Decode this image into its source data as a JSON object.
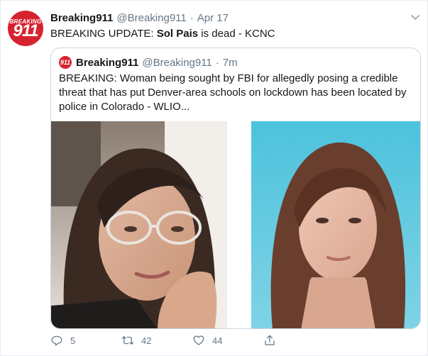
{
  "tweet": {
    "avatar": {
      "line1": "BREAKING",
      "line2": "911"
    },
    "display_name": "Breaking911",
    "handle": "@Breaking911",
    "separator": "·",
    "time": "Apr 17",
    "text_prefix": "BREAKING UPDATE: ",
    "text_bold": "Sol Pais",
    "text_suffix": " is dead - KCNC"
  },
  "quoted_tweet": {
    "avatar": "911",
    "display_name": "Breaking911",
    "handle": "@Breaking911",
    "separator": "·",
    "time": "7m",
    "text": "BREAKING: Woman being sought by FBI for allegedly posing a credible threat that has put Denver-area schools on lockdown has been located by police in Colorado - WLIO..."
  },
  "actions": {
    "reply_count": "5",
    "retweet_count": "42",
    "like_count": "44"
  },
  "icons": {
    "more": "chevron-down-icon",
    "reply": "reply-icon",
    "retweet": "retweet-icon",
    "like": "heart-icon",
    "share": "share-icon"
  },
  "colors": {
    "brand_red": "#d7232f",
    "secondary_text": "#657786",
    "border": "#ccd6dd"
  }
}
